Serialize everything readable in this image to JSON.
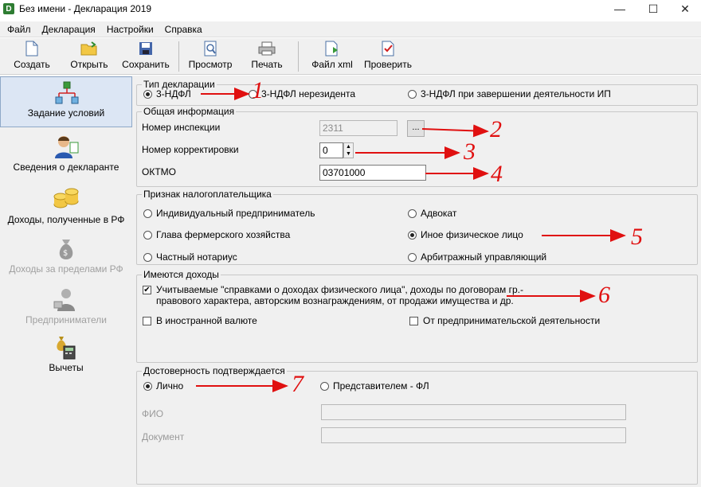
{
  "window": {
    "title": "Без имени - Декларация 2019",
    "icon_letter": "D"
  },
  "menu": [
    "Файл",
    "Декларация",
    "Настройки",
    "Справка"
  ],
  "toolbar": {
    "create": "Создать",
    "open": "Открыть",
    "save": "Сохранить",
    "preview": "Просмотр",
    "print": "Печать",
    "xml": "Файл xml",
    "check": "Проверить"
  },
  "nav": {
    "conditions": "Задание условий",
    "declarant": "Сведения о декларанте",
    "income_rf": "Доходы, полученные в РФ",
    "income_abroad": "Доходы за пределами РФ",
    "entrepreneurs": "Предприниматели",
    "deductions": "Вычеты"
  },
  "decl_type": {
    "legend": "Тип декларации",
    "options": [
      "3-НДФЛ",
      "3-НДФЛ нерезидента",
      "3-НДФЛ при завершении деятельности ИП"
    ],
    "selected": "3-НДФЛ"
  },
  "general": {
    "legend": "Общая информация",
    "inspection_label": "Номер инспекции",
    "inspection_value": "2311",
    "inspection_btn": "...",
    "correction_label": "Номер корректировки",
    "correction_value": "0",
    "oktmo_label": "ОКТМО",
    "oktmo_value": "03701000"
  },
  "taxpayer": {
    "legend": "Признак налогоплательщика",
    "options": [
      "Индивидуальный предприниматель",
      "Адвокат",
      "Глава фермерского хозяйства",
      "Иное физическое лицо",
      "Частный нотариус",
      "Арбитражный управляющий"
    ],
    "selected": "Иное физическое лицо"
  },
  "incomes": {
    "legend": "Имеются доходы",
    "certified": "Учитываемые \"справками о доходах физического лица\", доходы по договорам гр.-правового характера, авторским вознаграждениям, от продажи имущества и др.",
    "certified_checked": true,
    "foreign": "В иностранной валюте",
    "foreign_checked": false,
    "business": "От предпринимательской деятельности",
    "business_checked": false
  },
  "confirm": {
    "legend": "Достоверность подтверждается",
    "personal": "Лично",
    "representative": "Представителем - ФЛ",
    "selected": "Лично",
    "fio_label": "ФИО",
    "doc_label": "Документ"
  },
  "annotations": [
    "1",
    "2",
    "3",
    "4",
    "5",
    "6",
    "7"
  ],
  "colors": {
    "annotation": "#e01010",
    "active_nav": "#dce6f4"
  }
}
